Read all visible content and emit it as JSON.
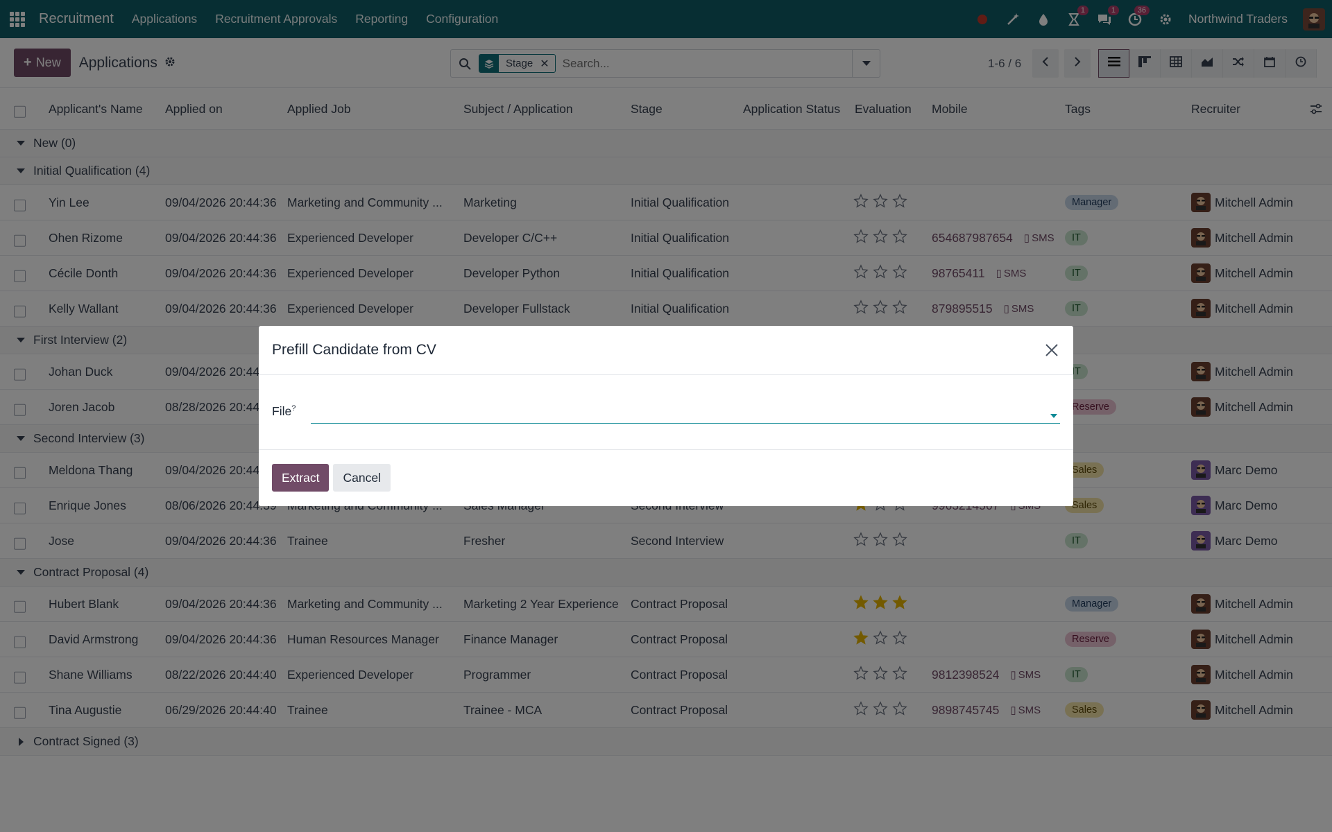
{
  "topbar": {
    "brand": "Recruitment",
    "menu": [
      "Applications",
      "Recruitment Approvals",
      "Reporting",
      "Configuration"
    ],
    "badges": {
      "activity": "1",
      "messages": "1",
      "clock": "36"
    },
    "company": "Northwind Traders"
  },
  "control": {
    "new_label": "New",
    "title": "Applications",
    "facet_label": "Stage",
    "search_placeholder": "Search...",
    "pager": "1-6 / 6"
  },
  "columns": [
    "Applicant's Name",
    "Applied on",
    "Applied Job",
    "Subject / Application",
    "Stage",
    "Application Status",
    "Evaluation",
    "Mobile",
    "Tags",
    "Recruiter"
  ],
  "groups": {
    "g1": "New (0)",
    "g2": "Initial Qualification (4)",
    "g3": "First Interview (2)",
    "g4": "Second Interview (3)",
    "g5": "Contract Proposal (4)",
    "g6": "Contract Signed (3)"
  },
  "rows": [
    {
      "name": "Yin Lee",
      "applied": "09/04/2026 20:44:36",
      "job": "Marketing and Community ...",
      "subject": "Marketing",
      "stage": "Initial Qualification",
      "stars": 0,
      "mobile": "",
      "sms": "",
      "tag": "Manager",
      "recruiter": "Mitchell Admin"
    },
    {
      "name": "Ohen Rizome",
      "applied": "09/04/2026 20:44:36",
      "job": "Experienced Developer",
      "subject": "Developer C/C++",
      "stage": "Initial Qualification",
      "stars": 0,
      "mobile": "654687987654",
      "sms": "SMS",
      "tag": "IT",
      "recruiter": "Mitchell Admin"
    },
    {
      "name": "Cécile Donth",
      "applied": "09/04/2026 20:44:36",
      "job": "Experienced Developer",
      "subject": "Developer Python",
      "stage": "Initial Qualification",
      "stars": 0,
      "mobile": "98765411",
      "sms": "SMS",
      "tag": "IT",
      "recruiter": "Mitchell Admin"
    },
    {
      "name": "Kelly Wallant",
      "applied": "09/04/2026 20:44:36",
      "job": "Experienced Developer",
      "subject": "Developer Fullstack",
      "stage": "Initial Qualification",
      "stars": 0,
      "mobile": "879895515",
      "sms": "SMS",
      "tag": "IT",
      "recruiter": "Mitchell Admin"
    },
    {
      "name": "Johan Duck",
      "applied": "09/04/2026 20:44",
      "job": "",
      "subject": "",
      "stage": "",
      "stars": null,
      "mobile": "",
      "sms": "",
      "tag": "IT",
      "recruiter": "Mitchell Admin"
    },
    {
      "name": "Joren Jacob",
      "applied": "08/28/2026 20:44",
      "job": "",
      "subject": "",
      "stage": "",
      "stars": null,
      "mobile": "",
      "sms": "",
      "tag": "Reserve",
      "recruiter": "Mitchell Admin"
    },
    {
      "name": "Meldona Thang",
      "applied": "09/04/2026 20:44",
      "job": "",
      "subject": "",
      "stage": "",
      "stars": null,
      "mobile": "",
      "sms": "",
      "tag": "Sales",
      "recruiter": "Marc Demo"
    },
    {
      "name": "Enrique Jones",
      "applied": "08/06/2026 20:44:39",
      "job": "Marketing and Community ...",
      "subject": "Sales Manager",
      "stage": "Second Interview",
      "stars": 1,
      "mobile": "9963214567",
      "sms": "SMS",
      "tag": "Sales",
      "recruiter": "Marc Demo"
    },
    {
      "name": "Jose",
      "applied": "09/04/2026 20:44:36",
      "job": "Trainee",
      "subject": "Fresher",
      "stage": "Second Interview",
      "stars": 0,
      "mobile": "",
      "sms": "",
      "tag": "IT",
      "recruiter": "Marc Demo"
    },
    {
      "name": "Hubert Blank",
      "applied": "09/04/2026 20:44:36",
      "job": "Marketing and Community ...",
      "subject": "Marketing 2 Year Experience",
      "stage": "Contract Proposal",
      "stars": 3,
      "mobile": "",
      "sms": "",
      "tag": "Manager",
      "recruiter": "Mitchell Admin"
    },
    {
      "name": "David Armstrong",
      "applied": "09/04/2026 20:44:36",
      "job": "Human Resources Manager",
      "subject": "Finance Manager",
      "stage": "Contract Proposal",
      "stars": 1,
      "mobile": "",
      "sms": "",
      "tag": "Reserve",
      "recruiter": "Mitchell Admin"
    },
    {
      "name": "Shane Williams",
      "applied": "08/22/2026 20:44:40",
      "job": "Experienced Developer",
      "subject": "Programmer",
      "stage": "Contract Proposal",
      "stars": 0,
      "mobile": "9812398524",
      "sms": "SMS",
      "tag": "IT",
      "recruiter": "Mitchell Admin"
    },
    {
      "name": "Tina Augustie",
      "applied": "06/29/2026 20:44:40",
      "job": "Trainee",
      "subject": "Trainee - MCA",
      "stage": "Contract Proposal",
      "stars": 0,
      "mobile": "9898745745",
      "sms": "SMS",
      "tag": "Sales",
      "recruiter": "Mitchell Admin"
    }
  ],
  "modal": {
    "title": "Prefill Candidate from CV",
    "field_label": "File",
    "field_help": "?",
    "field_value": "",
    "extract_label": "Extract",
    "cancel_label": "Cancel"
  },
  "colors": {
    "topbar": "#0f5c66",
    "primary": "#714b67",
    "star": "#e6b400"
  }
}
